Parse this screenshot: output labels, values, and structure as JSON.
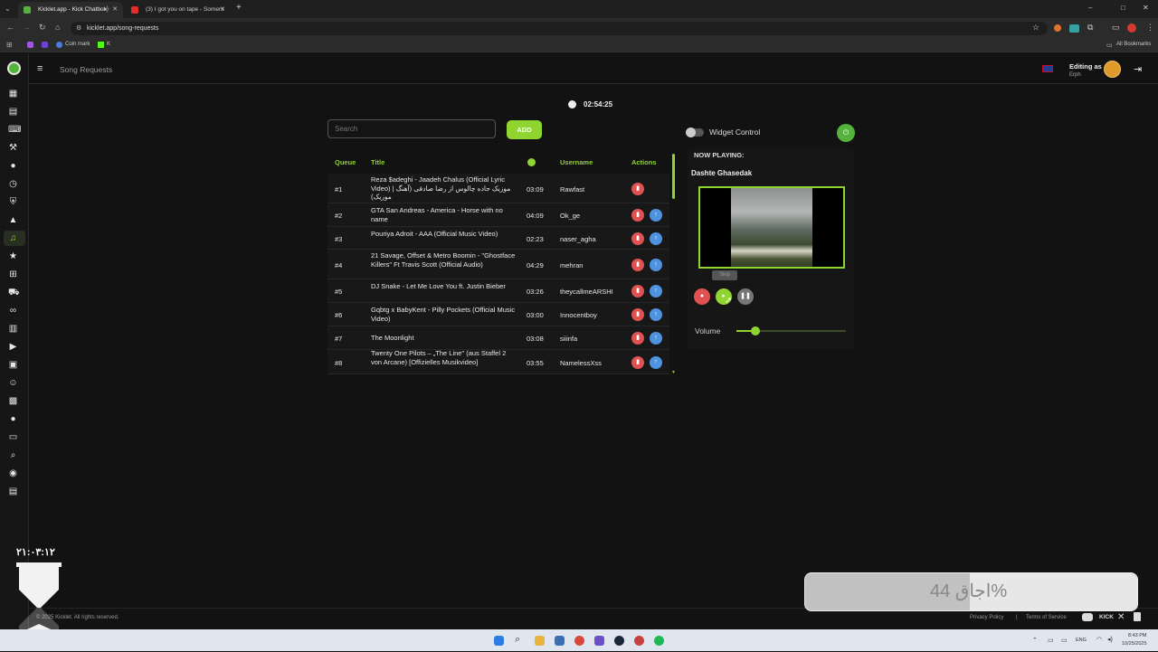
{
  "browser": {
    "tabs": [
      {
        "label": "Kicklet.app - Kick Chatbot",
        "active": true
      },
      {
        "label": "(3) I got you on tape - Somers",
        "active": false
      }
    ],
    "new_tab": "+",
    "url": "kicklet.app/song-requests",
    "bookmarks": [
      {
        "label": "Coin mark"
      },
      {
        "label": "K"
      }
    ],
    "all_bookmarks": "All Bookmarks",
    "window_controls": [
      "–",
      "□",
      "✕"
    ]
  },
  "app": {
    "page_title": "Song Requests",
    "editing_as_label": "Editing as",
    "editing_as_user": "Erph",
    "timer": "02:54:25",
    "search_placeholder": "Search",
    "add_button": "ADD",
    "footer_copyright": "© 2025 Kicklet. All rights reserved.",
    "footer_links": [
      "Privacy Policy",
      "|",
      "Terms of Service"
    ],
    "footer_social": [
      "Discord",
      "KICK",
      "X",
      "Docs"
    ]
  },
  "table": {
    "headers": {
      "queue": "Queue",
      "title": "Title",
      "duration": "clock-icon",
      "username": "Username",
      "actions": "Actions"
    },
    "rows": [
      {
        "queue": "#1",
        "title": "Reza $adeghi - Jaadeh Chalus (Official Lyric Video) | موزیک جاده چالوس از رضا صادقی (آهنگ موزیک)",
        "duration": "03:09",
        "username": "Rawfast",
        "up": false
      },
      {
        "queue": "#2",
        "title": "GTA San Andreas - America - Horse with no name",
        "duration": "04:09",
        "username": "Ok_ge",
        "up": true
      },
      {
        "queue": "#3",
        "title": "Pouriya Adroit - AAA (Official Music Video)",
        "duration": "02:23",
        "username": "naser_agha",
        "up": true
      },
      {
        "queue": "#4",
        "title": "21 Savage, Offset & Metro Boomin - \"Ghostface Killers\" Ft Travis Scott (Official Audio)",
        "duration": "04:29",
        "username": "mehran",
        "up": true
      },
      {
        "queue": "#5",
        "title": "DJ Snake - Let Me Love You ft. Justin Bieber",
        "duration": "03:26",
        "username": "theycallmeARSHI",
        "up": true
      },
      {
        "queue": "#6",
        "title": "Gqbtg x BabyKent - Pilly Pockets (Official Music Video)",
        "duration": "03:00",
        "username": "Innocentboy",
        "up": true
      },
      {
        "queue": "#7",
        "title": "The Moonlight",
        "duration": "03:08",
        "username": "siiinfa",
        "up": true
      },
      {
        "queue": "#8",
        "title": "Twenty One Pilots – „The Line\" (aus Staffel 2 von Arcane) [Offizielles Musikvideo]",
        "duration": "03:55",
        "username": "NamelessXss",
        "up": true
      }
    ]
  },
  "player": {
    "widget_control": "Widget Control",
    "now_playing_label": "NOW PLAYING:",
    "now_playing_title": "Dashte Ghasedak",
    "skip_tooltip": "Skip",
    "volume_label": "Volume",
    "volume_value": 0.17
  },
  "overlay": {
    "clock": "۲۱:۰۳:۱۲",
    "badge_text": "اجاق 44%"
  },
  "taskbar": {
    "lang": "ENG",
    "time": "8:43 PM",
    "date": "10/25/2025"
  },
  "colors": {
    "accent_green": "#8fd42f",
    "delete_red": "#e05252",
    "up_blue": "#4f93e0"
  }
}
